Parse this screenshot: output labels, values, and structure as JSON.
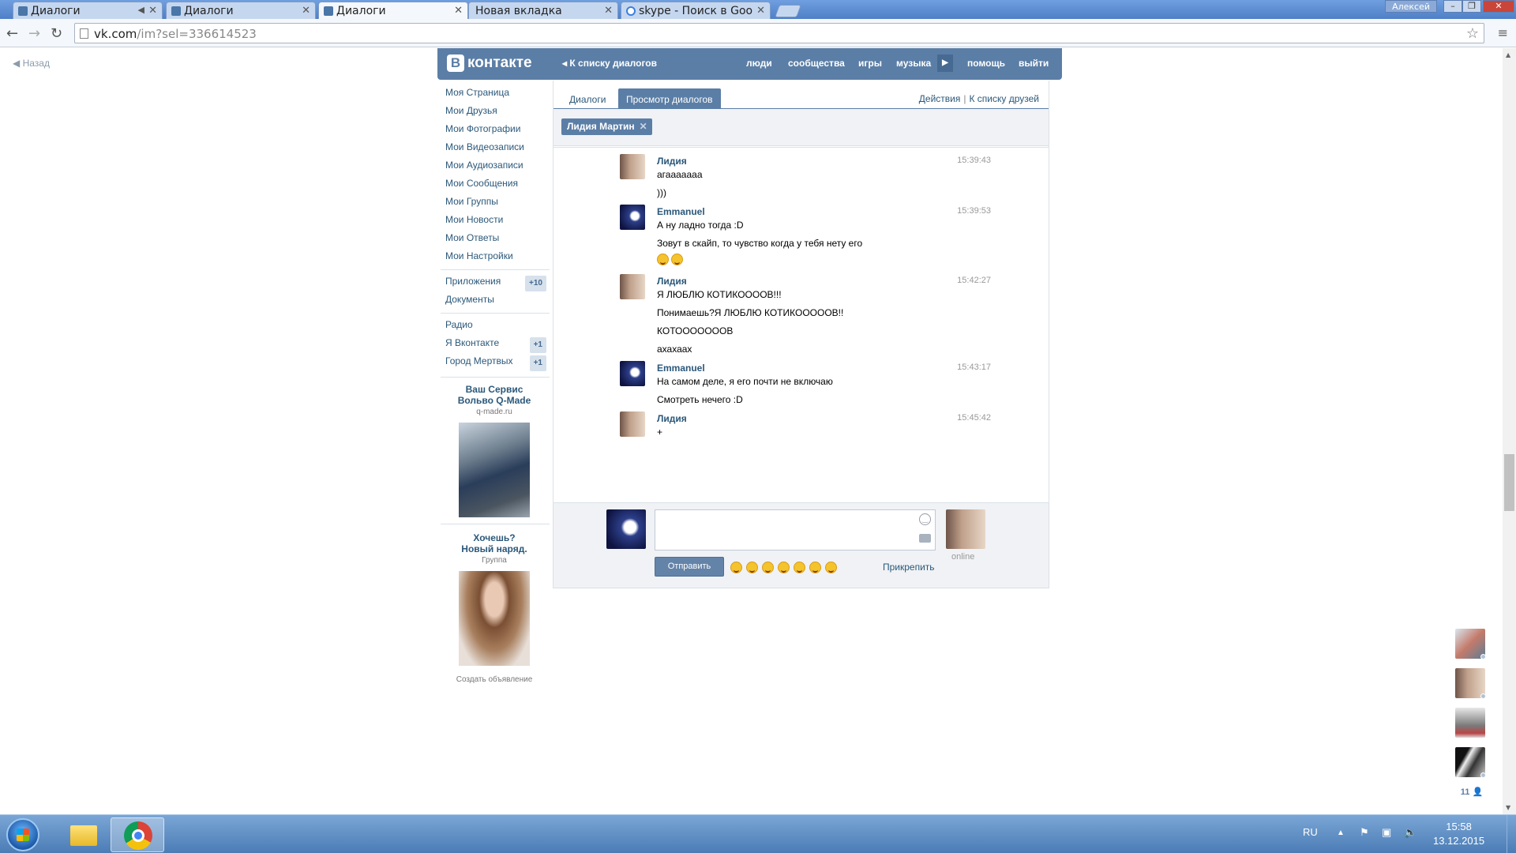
{
  "browser": {
    "tabs": [
      {
        "label": "Диалоги",
        "muted": true
      },
      {
        "label": "Диалоги"
      },
      {
        "label": "Диалоги",
        "active": true
      },
      {
        "label": "Новая вкладка"
      },
      {
        "label": "skype - Поиск в Goo"
      }
    ],
    "user": "Алексей",
    "url_host": "vk.com",
    "url_path": "/im?sel=336614523"
  },
  "page": {
    "back": "Назад"
  },
  "header": {
    "logo": "контакте",
    "logo_letter": "В",
    "to_list": "К списку диалогов",
    "nav": [
      "люди",
      "сообщества",
      "игры",
      "музыка",
      "помощь",
      "выйти"
    ]
  },
  "sidebar": {
    "items": [
      "Моя Страница",
      "Мои Друзья",
      "Мои Фотографии",
      "Мои Видеозаписи",
      "Мои Аудиозаписи",
      "Мои Сообщения",
      "Мои Группы",
      "Мои Новости",
      "Мои Ответы",
      "Мои Настройки"
    ],
    "apps": {
      "label": "Приложения",
      "badge": "+10"
    },
    "docs": "Документы",
    "radio": "Радио",
    "vkontakte": {
      "label": "Я Вконтакте",
      "badge": "+1"
    },
    "dead_city": {
      "label": "Город Мертвых",
      "badge": "+1"
    },
    "ad1": {
      "title1": "Ваш Сервис",
      "title2": "Вольво Q-Made",
      "site": "q-made.ru"
    },
    "ad2": {
      "title1": "Хочешь?",
      "title2": "Новый наряд.",
      "sub": "Группа"
    },
    "create_ad": "Создать объявление"
  },
  "dialog": {
    "tab_dialogs": "Диалоги",
    "tab_view": "Просмотр диалогов",
    "actions": "Действия",
    "to_friends": "К списку друзей",
    "chip": "Лидия Мартин",
    "messages": [
      {
        "author": "Лидия",
        "time": "15:39:43",
        "lines": [
          "агааааааа",
          ")))"
        ]
      },
      {
        "author": "Emmanuel",
        "time": "15:39:53",
        "lines": [
          "А ну ладно тогда :D",
          "Зовут в скайп, то чувство когда у тебя нету его"
        ]
      },
      {
        "author": "Лидия",
        "time": "15:42:27",
        "lines": [
          "Я ЛЮБЛЮ КОТИКООООВ!!!",
          "Понимаешь?Я ЛЮБЛЮ КОТИКОООООВ!!",
          "КОТОООООООВ",
          "ахахаах"
        ]
      },
      {
        "author": "Emmanuel",
        "time": "15:43:17",
        "lines": [
          "На самом деле, я его почти не включаю",
          "Смотреть нечего :D"
        ]
      },
      {
        "author": "Лидия",
        "time": "15:45:42",
        "lines": [
          "+"
        ]
      }
    ],
    "send": "Отправить",
    "attach": "Прикрепить",
    "status": "online"
  },
  "friends_count": "11",
  "taskbar": {
    "lang": "RU",
    "time": "15:58",
    "date": "13.12.2015"
  }
}
